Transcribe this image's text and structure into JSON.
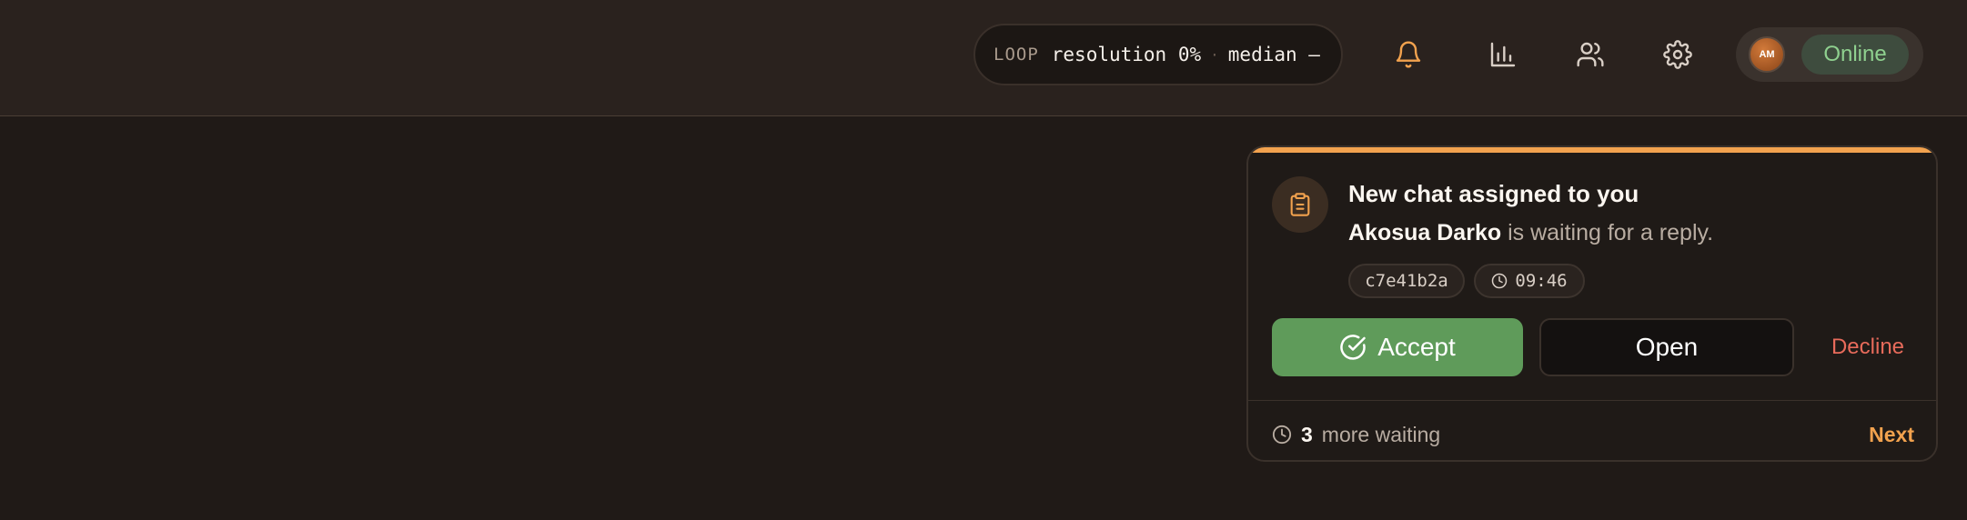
{
  "topbar": {
    "loop": {
      "tag": "LOOP",
      "resolution": "resolution 0%",
      "separator": "·",
      "median": "median —"
    },
    "icons": [
      "bell-icon",
      "bar-chart-icon",
      "users-icon",
      "gear-icon"
    ],
    "user": {
      "initials": "AM",
      "status": "Online"
    }
  },
  "notification": {
    "title": "New chat assigned to you",
    "customer_name": "Akosua Darko",
    "message": " is waiting for a reply.",
    "chat_id": "c7e41b2a",
    "time": "09:46",
    "accept_label": "Accept",
    "open_label": "Open",
    "decline_label": "Decline",
    "queue_count": "3",
    "queue_text": "more waiting",
    "next_label": "Next"
  },
  "colors": {
    "accent": "#f2a24e",
    "accept": "#5f9b5a",
    "decline": "#e86b5b",
    "online": "#8fd08f"
  }
}
